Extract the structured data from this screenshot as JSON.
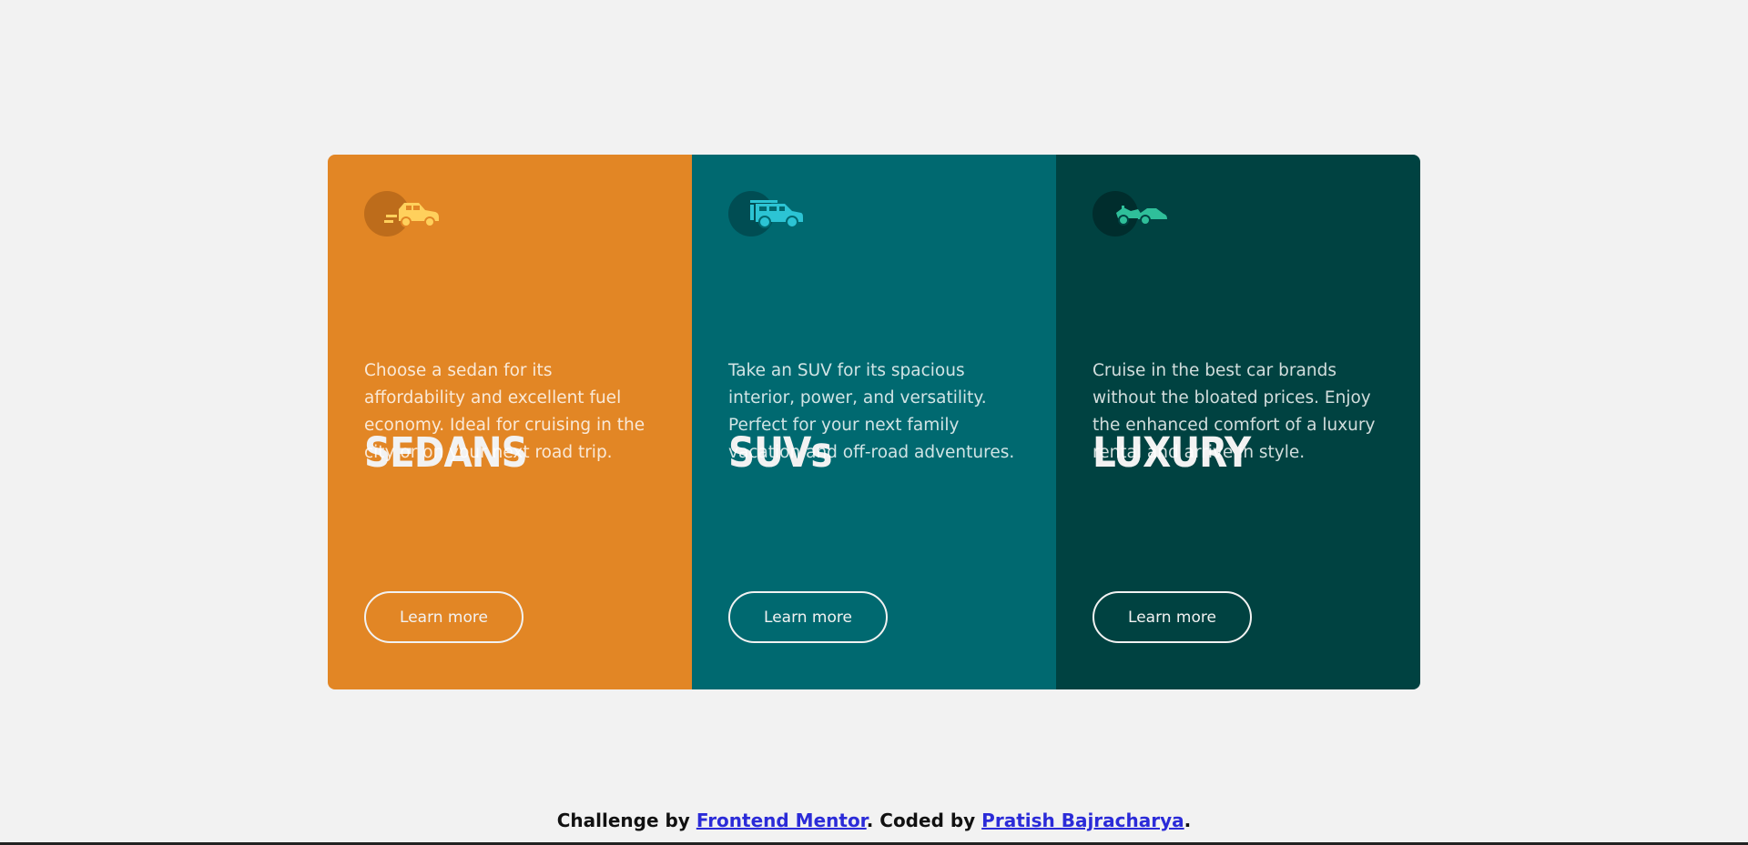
{
  "cards": [
    {
      "title": "SEDANS",
      "description": "Choose a sedan for its affordability and excellent fuel economy. Ideal for cruising in the city or on your next road trip.",
      "button_label": "Learn more",
      "icon": "sedan-car-icon",
      "bg_color": "#e28625",
      "icon_color": "#ffd05c"
    },
    {
      "title": "SUVs",
      "description": "Take an SUV for its spacious interior, power, and versatility. Perfect for your next family vacation and off-road adventures.",
      "button_label": "Learn more",
      "icon": "suv-car-icon",
      "bg_color": "#006970",
      "icon_color": "#2cc4d4"
    },
    {
      "title": "LUXURY",
      "description": "Cruise in the best car brands without the bloated prices. Enjoy the enhanced comfort of a luxury rental and arrive in style.",
      "button_label": "Learn more",
      "icon": "luxury-car-icon",
      "bg_color": "#004241",
      "icon_color": "#2fbf9a"
    }
  ],
  "attribution": {
    "prefix": "Challenge by ",
    "mentor_link": "Frontend Mentor",
    "middle": ". Coded by ",
    "author_link": "Pratish Bajracharya",
    "suffix": "."
  }
}
